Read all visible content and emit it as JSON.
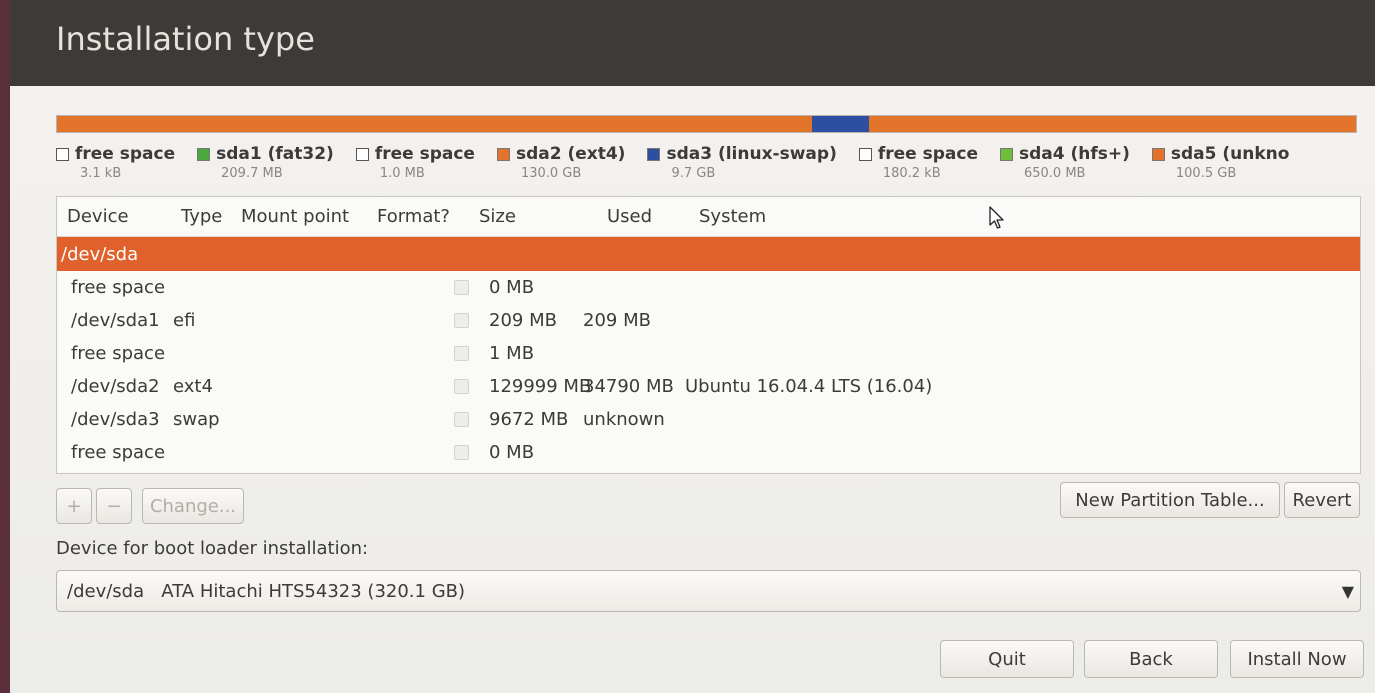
{
  "title": "Installation type",
  "colors": {
    "free": "#ffffff",
    "fat32": "#4aa83c",
    "ext4": "#e2732b",
    "swap": "#2c4fa0",
    "hfs": "#6fbe3c",
    "unknown": "#e2732b",
    "selection": "#e0612b"
  },
  "legend": [
    {
      "label": "free space",
      "size": "3.1 kB",
      "kind": "free"
    },
    {
      "label": "sda1 (fat32)",
      "size": "209.7 MB",
      "kind": "fat32"
    },
    {
      "label": "free space",
      "size": "1.0 MB",
      "kind": "free"
    },
    {
      "label": "sda2 (ext4)",
      "size": "130.0 GB",
      "kind": "ext4"
    },
    {
      "label": "sda3 (linux-swap)",
      "size": "9.7 GB",
      "kind": "swap"
    },
    {
      "label": "free space",
      "size": "180.2 kB",
      "kind": "free"
    },
    {
      "label": "sda4 (hfs+)",
      "size": "650.0 MB",
      "kind": "hfs"
    },
    {
      "label": "sda5 (unkno",
      "size": "100.5 GB",
      "kind": "unknown"
    }
  ],
  "table": {
    "headers": {
      "device": "Device",
      "type": "Type",
      "mount": "Mount point",
      "format": "Format?",
      "size": "Size",
      "used": "Used",
      "system": "System"
    },
    "rows": [
      {
        "device": "/dev/sda",
        "type": "",
        "mount": "",
        "size": "",
        "used": "",
        "system": "",
        "selected": true,
        "checkbox": false
      },
      {
        "device": "free space",
        "type": "",
        "mount": "",
        "size": "0 MB",
        "used": "",
        "system": "",
        "selected": false,
        "checkbox": true
      },
      {
        "device": "/dev/sda1",
        "type": "efi",
        "mount": "",
        "size": "209 MB",
        "used": "209 MB",
        "system": "",
        "selected": false,
        "checkbox": true
      },
      {
        "device": "free space",
        "type": "",
        "mount": "",
        "size": "1 MB",
        "used": "",
        "system": "",
        "selected": false,
        "checkbox": true
      },
      {
        "device": "/dev/sda2",
        "type": "ext4",
        "mount": "",
        "size": "129999 MB",
        "used": "34790 MB",
        "system": "Ubuntu 16.04.4 LTS (16.04)",
        "selected": false,
        "checkbox": true
      },
      {
        "device": "/dev/sda3",
        "type": "swap",
        "mount": "",
        "size": "9672 MB",
        "used": "unknown",
        "system": "",
        "selected": false,
        "checkbox": true
      },
      {
        "device": "free space",
        "type": "",
        "mount": "",
        "size": "0 MB",
        "used": "",
        "system": "",
        "selected": false,
        "checkbox": true
      }
    ]
  },
  "buttons": {
    "add": "+",
    "remove": "−",
    "change": "Change...",
    "new_partition_table": "New Partition Table...",
    "revert": "Revert",
    "quit": "Quit",
    "back": "Back",
    "install_now": "Install Now"
  },
  "boot_loader": {
    "label": "Device for boot loader installation:",
    "selected": "/dev/sda   ATA Hitachi HTS54323 (320.1 GB)",
    "arrow": "▼"
  }
}
